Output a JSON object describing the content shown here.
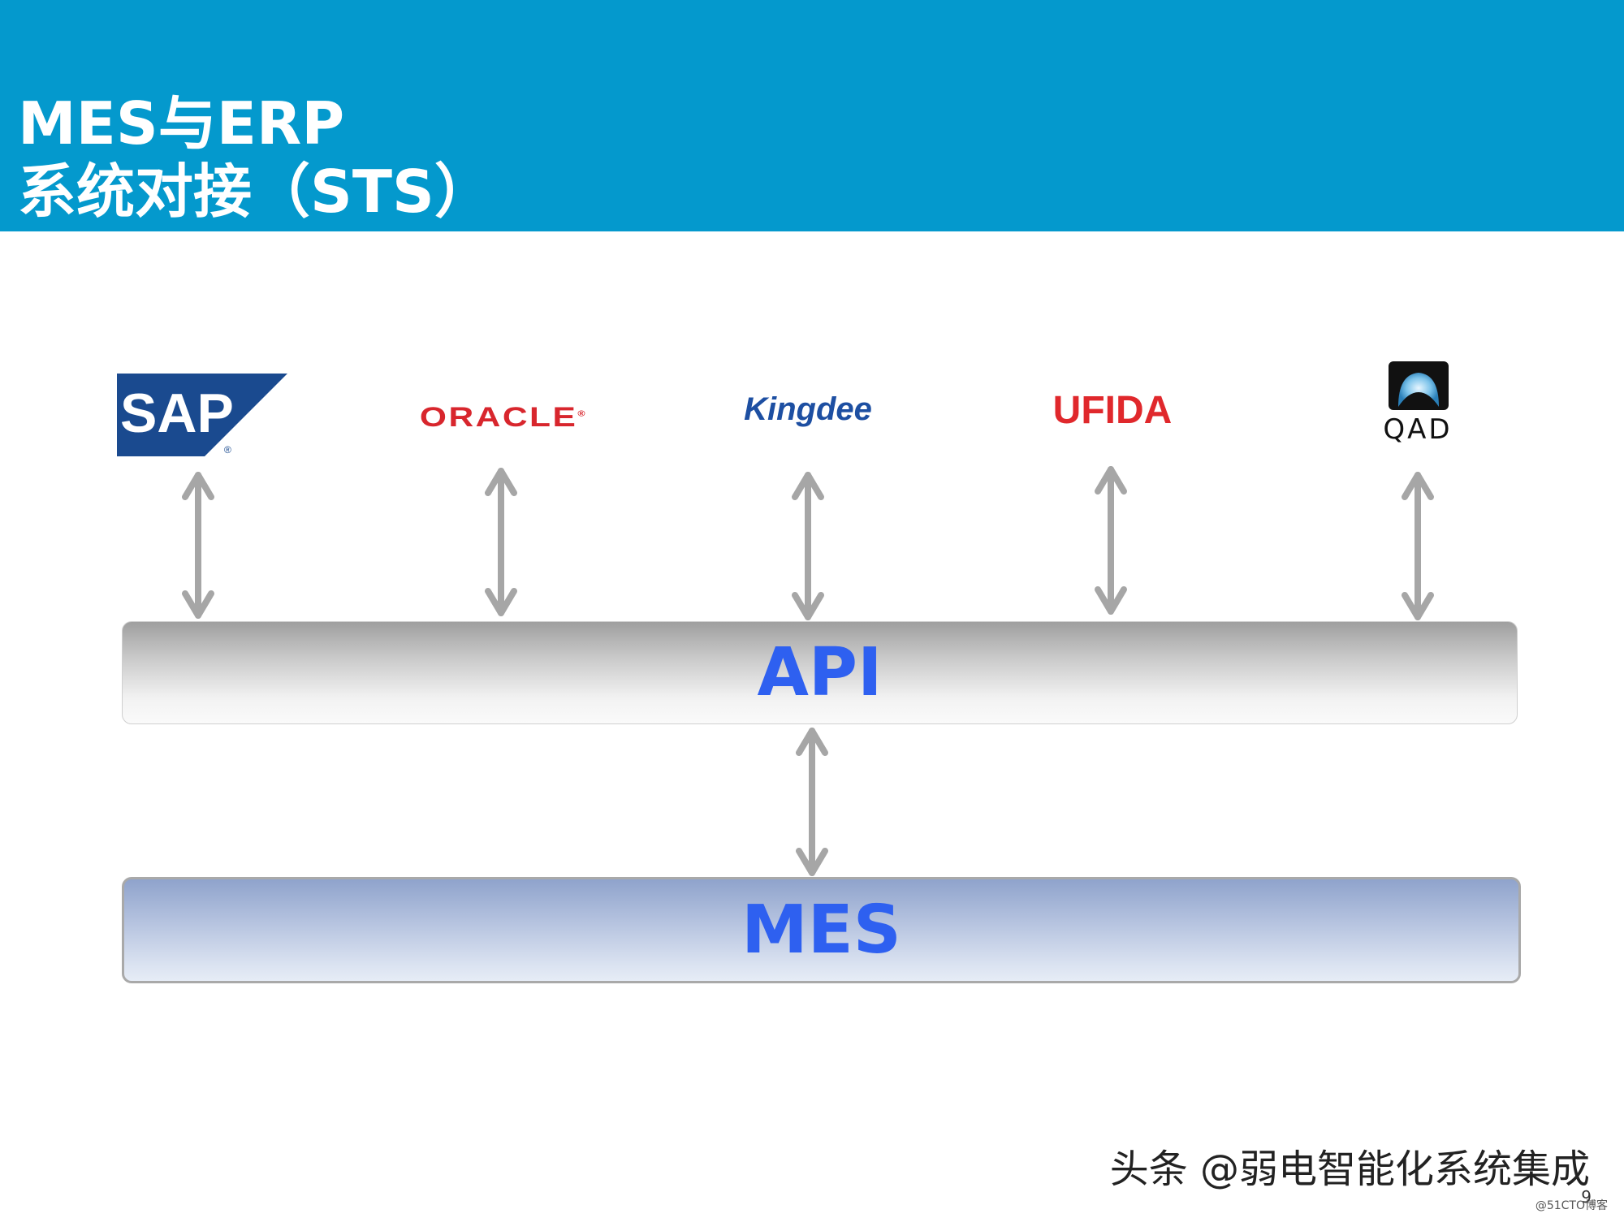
{
  "header": {
    "title_line1": "MES与ERP",
    "title_line2": "系统对接（STS）",
    "background": "#0499cd"
  },
  "vendors": [
    {
      "name": "SAP",
      "icon": "sap-logo"
    },
    {
      "name": "ORACLE",
      "icon": "oracle-logo"
    },
    {
      "name": "Kingdee",
      "icon": "kingdee-logo"
    },
    {
      "name": "UFIDA",
      "icon": "ufida-logo"
    },
    {
      "name": "QAD",
      "icon": "qad-logo"
    }
  ],
  "layers": {
    "api": "API",
    "mes": "MES"
  },
  "colors": {
    "label": "#2e60f0",
    "arrow": "#a6a6a6"
  },
  "footer": {
    "watermark": "头条 @弱电智能化系统集成",
    "page_number": "9",
    "site": "@51CTO博客"
  }
}
